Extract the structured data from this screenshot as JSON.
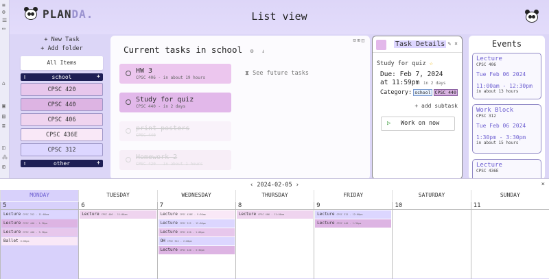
{
  "rail_icons": [
    "≡",
    "⚙",
    "☰",
    "▭",
    "⌂",
    "▣",
    "▤",
    "≣",
    "◫",
    "⁂",
    "⊞"
  ],
  "header": {
    "brand": "PLAN",
    "brand_suffix": "DA.",
    "title": "List view"
  },
  "sidebar": {
    "new_task": "+ New Task",
    "add_folder": "+ Add folder",
    "all_items": "All Items",
    "folders": [
      {
        "name": "school",
        "courses": [
          "CPSC 420",
          "CPSC 440",
          "CPSC 406",
          "CPSC 436E",
          "CPSC 312"
        ]
      },
      {
        "name": "other",
        "courses": []
      }
    ],
    "course_colors": [
      "#e7c7ec",
      "#ddb4e3",
      "#efd4ef",
      "#f9e8f7",
      "#dcd6ff"
    ]
  },
  "main": {
    "title": "Current tasks in school",
    "future_label": "See future tasks",
    "tasks": [
      {
        "title": "HW 3",
        "sub": "CPSC 406 - in about 19 hours",
        "color": "#ecc6ee",
        "state": "open"
      },
      {
        "title": "Study for quiz",
        "sub": "CPSC 440 - in 2 days",
        "color": "#e2b8ea",
        "state": "open"
      },
      {
        "title": "print posters",
        "sub": "CPSC 440",
        "color": "#f7ecf7",
        "state": "done"
      },
      {
        "title": "Homework 2",
        "sub": "CPSC 420 - in about 1 hours",
        "color": "#f3e4f3",
        "state": "done"
      }
    ]
  },
  "details": {
    "header": "Task Details",
    "name": "Study for quiz",
    "due_label": "Due: Feb 7, 2024",
    "due_time": "at 11:59pm",
    "due_rel": "in 2 days",
    "category_label": "Category:",
    "tags": [
      "school",
      "CPSC 440"
    ],
    "add_subtask": "+ add subtask",
    "work_on_now": "Work on now"
  },
  "events": {
    "title": "Events",
    "items": [
      {
        "name": "Lecture",
        "course": "CPSC 406",
        "date": "Tue Feb 06 2024",
        "time": "11:00am - 12:30pm",
        "rel": "in about 13 hours"
      },
      {
        "name": "Work Block",
        "course": "CPSC 312",
        "date": "Tue Feb 06 2024",
        "time": "1:30pm - 3:30pm",
        "rel": "in about 15 hours"
      },
      {
        "name": "Lecture",
        "course": "CPSC 436E",
        "date": "",
        "time": "",
        "rel": ""
      }
    ]
  },
  "calendar": {
    "date": "2024-02-05",
    "prev": "‹",
    "next": "›",
    "close": "×",
    "days": [
      {
        "name": "MONDAY",
        "num": "5",
        "today": true,
        "events": [
          {
            "label": "Lecture",
            "sub": "CPSC 312 - 11:00am",
            "color": "#dcd6ff"
          },
          {
            "label": "Lecture",
            "sub": "CPSC 440 - 1:30pm",
            "color": "#ddb4e3"
          },
          {
            "label": "Lecture",
            "sub": "CPSC 440 - 3:30pm",
            "color": "#e7c7ec"
          },
          {
            "label": "Ballet",
            "sub": "6:00pm",
            "color": "#f9e8f7"
          }
        ]
      },
      {
        "name": "TUESDAY",
        "num": "6",
        "today": false,
        "events": [
          {
            "label": "Lecture",
            "sub": "CPSC 406 - 11:00am",
            "color": "#efd4ef"
          }
        ]
      },
      {
        "name": "WEDNESDAY",
        "num": "7",
        "today": false,
        "events": [
          {
            "label": "Lecture",
            "sub": "CPSC 436E - 9:30am",
            "color": "#f9e8f7"
          },
          {
            "label": "Lecture",
            "sub": "CPSC 312 - 12:00pm",
            "color": "#dcd6ff"
          },
          {
            "label": "Lecture",
            "sub": "CPSC 420 - 1:00pm",
            "color": "#e7c7ec"
          },
          {
            "label": "OH",
            "sub": "CPSC 312 - 2:00pm",
            "color": "#dcd6ff"
          },
          {
            "label": "Lecture",
            "sub": "CPSC 440 - 3:30pm",
            "color": "#ddb4e3"
          }
        ]
      },
      {
        "name": "THURSDAY",
        "num": "8",
        "today": false,
        "events": [
          {
            "label": "Lecture",
            "sub": "CPSC 406 - 11:00am",
            "color": "#efd4ef"
          }
        ]
      },
      {
        "name": "FRIDAY",
        "num": "9",
        "today": false,
        "events": [
          {
            "label": "Lecture",
            "sub": "CPSC 312 - 12:00pm",
            "color": "#dcd6ff"
          },
          {
            "label": "Lecture",
            "sub": "CPSC 440 - 1:30pm",
            "color": "#ddb4e3"
          }
        ]
      },
      {
        "name": "SATURDAY",
        "num": "10",
        "today": false,
        "events": []
      },
      {
        "name": "SUNDAY",
        "num": "11",
        "today": false,
        "events": []
      }
    ]
  }
}
